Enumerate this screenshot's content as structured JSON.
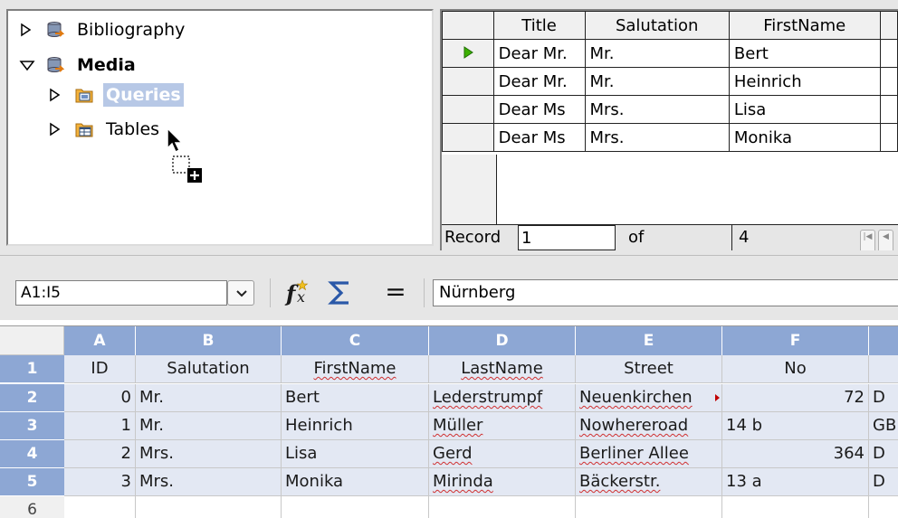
{
  "tree": {
    "items": [
      {
        "label": "Bibliography",
        "expanded": false,
        "icon": "database-icon"
      },
      {
        "label": "Media",
        "expanded": true,
        "icon": "database-icon"
      },
      {
        "label": "Queries",
        "expanded": false,
        "icon": "queries-folder-icon",
        "selected": true
      },
      {
        "label": "Tables",
        "expanded": false,
        "icon": "tables-folder-icon"
      }
    ]
  },
  "datagrid": {
    "headers": [
      "Title",
      "Salutation",
      "FirstName"
    ],
    "rows": [
      [
        "Dear Mr.",
        "Mr.",
        "Bert"
      ],
      [
        "Dear Mr.",
        "Mr.",
        "Heinrich"
      ],
      [
        "Dear Ms",
        "Mrs.",
        "Lisa"
      ],
      [
        "Dear Ms",
        "Mrs.",
        "Monika"
      ]
    ],
    "current_row": 0,
    "record_label": "Record",
    "record_value": "1",
    "of_label": "of",
    "total": "4"
  },
  "formula_bar": {
    "name_box": "A1:I5",
    "content": "Nürnberg"
  },
  "sheet": {
    "columns": [
      "A",
      "B",
      "C",
      "D",
      "E",
      "F"
    ],
    "row_headers": [
      "1",
      "2",
      "3",
      "4",
      "5",
      "6"
    ],
    "header_row": [
      "ID",
      "Salutation",
      "FirstName",
      "LastName",
      "Street",
      "No"
    ],
    "rows": [
      [
        "0",
        "Mr.",
        "Bert",
        "Lederstrumpf",
        "Neuenkirchen",
        "72",
        "D"
      ],
      [
        "1",
        "Mr.",
        "Heinrich",
        "Müller",
        "Nowhereroad",
        "14 b",
        "GB"
      ],
      [
        "2",
        "Mrs.",
        "Lisa",
        "Gerd",
        "Berliner Allee",
        "364",
        "D"
      ],
      [
        "3",
        "Mrs.",
        "Monika",
        "Mirinda",
        "Bäckerstr.",
        "13 a",
        "D"
      ]
    ]
  },
  "colors": {
    "selection_header": "#8da7d4",
    "selection_cell": "#e3e8f3",
    "tree_selection": "#b7c8e6",
    "current_row_arrow": "#3cb000"
  }
}
